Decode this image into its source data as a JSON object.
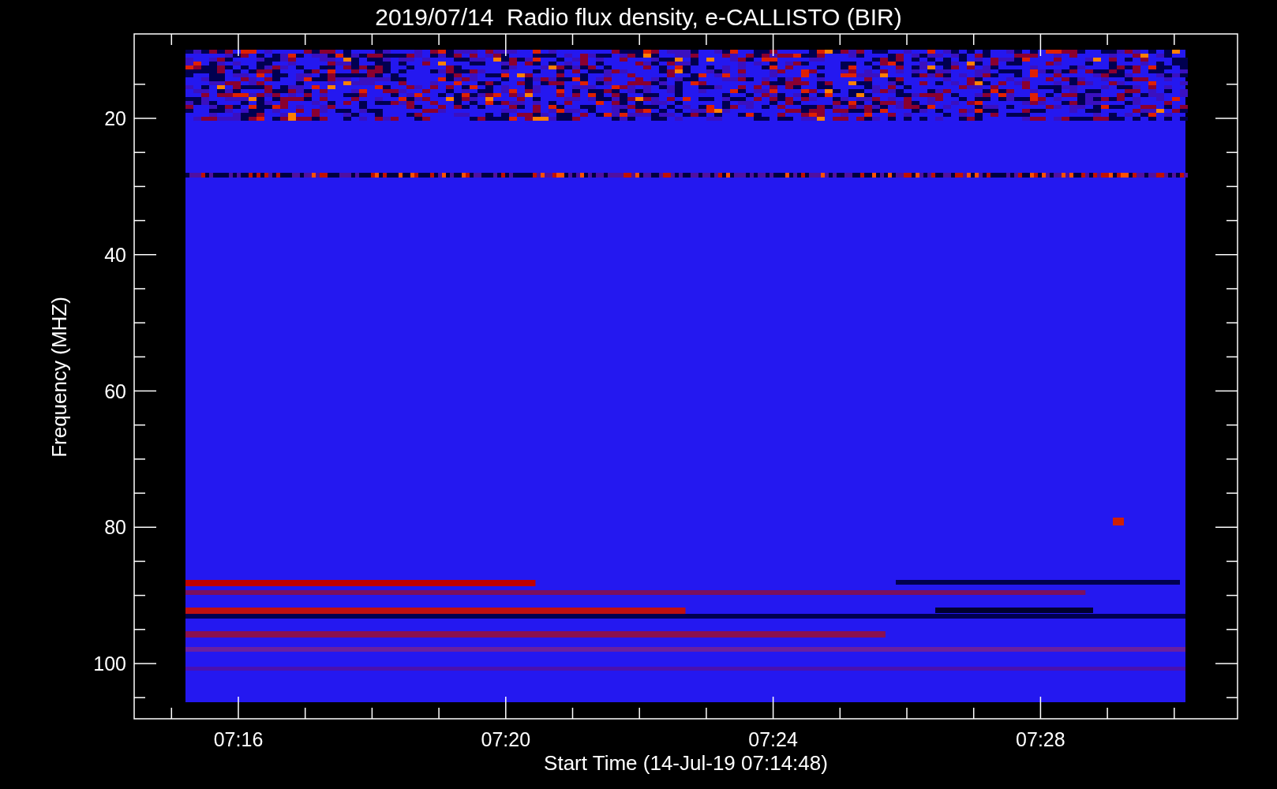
{
  "title": "2019/07/14  Radio flux density, e-CALLISTO (BIR)",
  "y_axis": {
    "label": "Frequency (MHZ)",
    "ticks": [
      "20",
      "40",
      "60",
      "80",
      "100"
    ]
  },
  "x_axis": {
    "label": "Start Time (14-Jul-19 07:14:48)",
    "ticks": [
      "07:16",
      "07:20",
      "07:24",
      "07:28"
    ]
  }
}
